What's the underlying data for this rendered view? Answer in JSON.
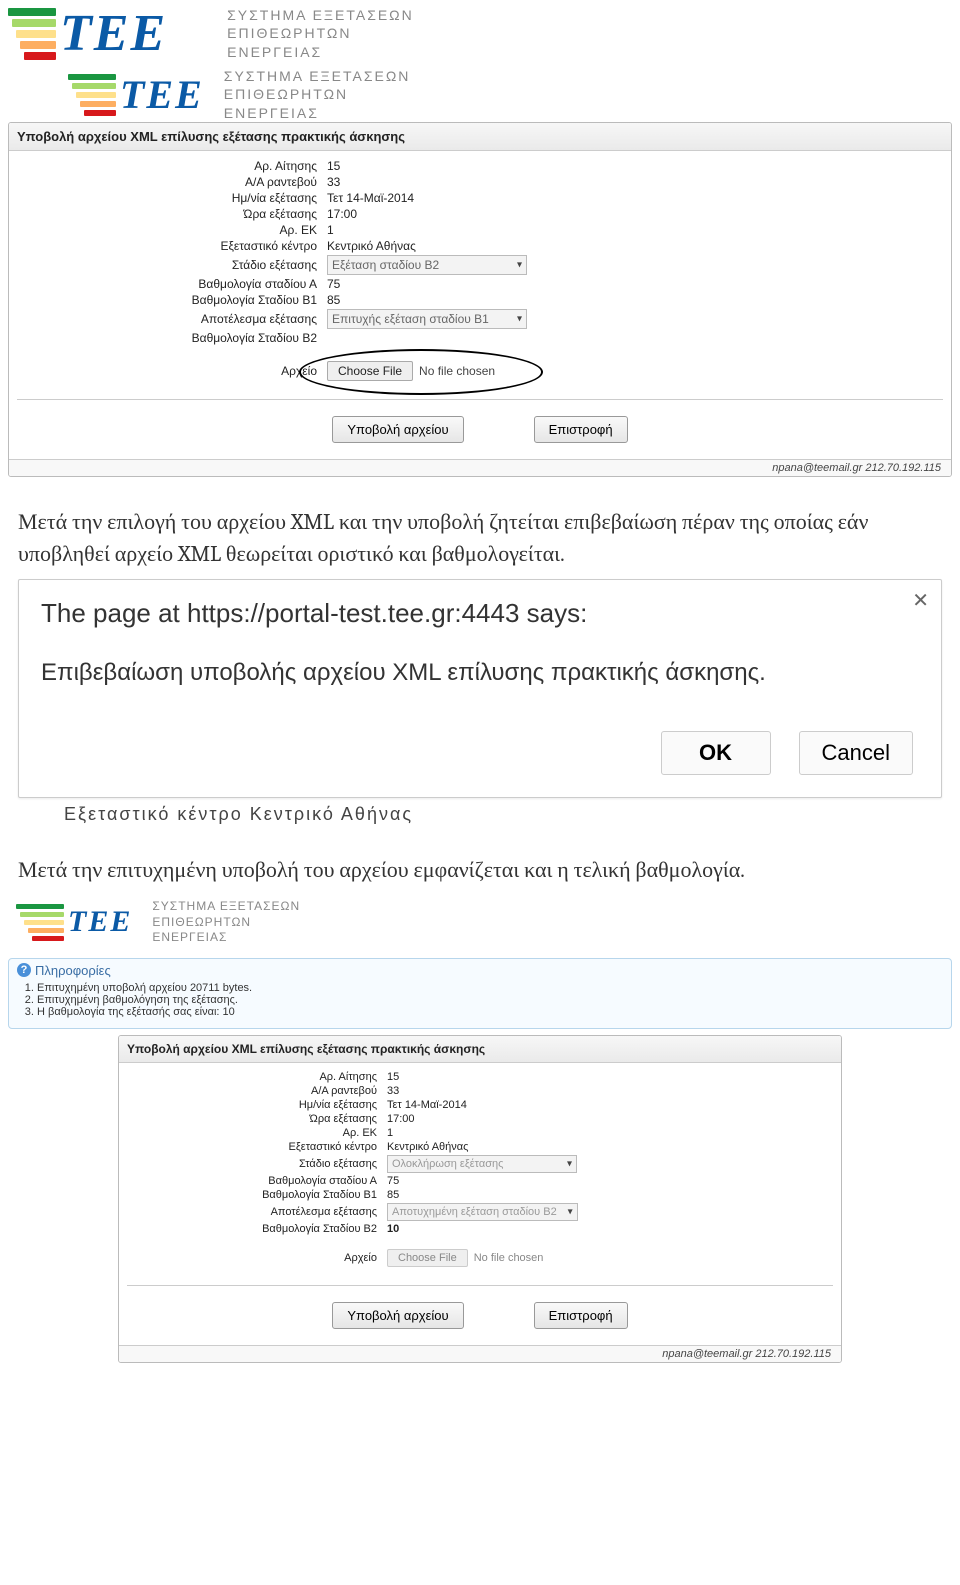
{
  "brand": {
    "name": "ΤΕΕ"
  },
  "system_title": {
    "l1": "ΣΥΣΤΗΜΑ ΕΞΕΤΑΣΕΩΝ",
    "l2": "ΕΠΙΘΕΩΡΗΤΩΝ",
    "l3": "ΕΝΕΡΓΕΙΑΣ"
  },
  "panel1": {
    "title": "Υποβολή αρχείου XML επίλυσης εξέτασης πρακτικής άσκησης",
    "labels": {
      "app_no": "Αρ. Αίτησης",
      "rv_no": "Α/Α ραντεβού",
      "exam_date": "Ημ/νία εξέτασης",
      "exam_time": "Ώρα εξέτασης",
      "ek_no": "Αρ. ΕΚ",
      "center": "Εξεταστικό κέντρο",
      "stage": "Στάδιο εξέτασης",
      "grade_a": "Βαθμολογία σταδίου Α",
      "grade_b1": "Βαθμολογία Σταδίου Β1",
      "result": "Αποτέλεσμα εξέτασης",
      "grade_b2": "Βαθμολογία Σταδίου Β2",
      "file": "Αρχείο"
    },
    "values": {
      "app_no": "15",
      "rv_no": "33",
      "exam_date": "Τετ 14-Μαϊ-2014",
      "exam_time": "17:00",
      "ek_no": "1",
      "center": "Κεντρικό Αθήνας",
      "stage": "Εξέταση σταδίου Β2",
      "grade_a": "75",
      "grade_b1": "85",
      "result": "Επιτυχής εξέταση σταδίου Β1",
      "grade_b2": ""
    },
    "file_chooser": {
      "button": "Choose File",
      "status": "No file chosen"
    },
    "buttons": {
      "submit": "Υποβολή αρχείου",
      "back": "Επιστροφή"
    },
    "footer": "npana@teemail.gr   212.70.192.115"
  },
  "para1": "Μετά την επιλογή του αρχείου XML και την υποβολή ζητείται επιβεβαίωση πέραν της οποίας εάν υποβληθεί αρχείο XML θεωρείται οριστικό και βαθμολογείται.",
  "dialog": {
    "title": "The page at https://portal-test.tee.gr:4443 says:",
    "message": "Επιβεβαίωση υποβολής αρχείου XML επίλυσης πρακτικής άσκησης.",
    "ok": "OK",
    "cancel": "Cancel"
  },
  "cropped_underlay": "Εξεταστικό κέντρο    Κεντρικό Αθήνας",
  "para2": "Μετά την επιτυχημένη υποβολή του αρχείου εμφανίζεται και η τελική βαθμολογία.",
  "info": {
    "title": "Πληροφορίες",
    "items": [
      "Επιτυχημένη υποβολή αρχείου 20711 bytes.",
      "Επιτυχημένη βαθμολόγηση της εξέτασης.",
      "Η βαθμολογία της εξέτασής σας είναι: 10"
    ]
  },
  "panel2": {
    "title": "Υποβολή αρχείου XML επίλυσης εξέτασης πρακτικής άσκησης",
    "values": {
      "app_no": "15",
      "rv_no": "33",
      "exam_date": "Τετ 14-Μαϊ-2014",
      "exam_time": "17:00",
      "ek_no": "1",
      "center": "Κεντρικό Αθήνας",
      "stage": "Ολοκλήρωση εξέτασης",
      "grade_a": "75",
      "grade_b1": "85",
      "result": "Αποτυχημένη εξέταση σταδίου Β2",
      "grade_b2": "10"
    },
    "file_chooser": {
      "button": "Choose File",
      "status": "No file chosen"
    },
    "buttons": {
      "submit": "Υποβολή αρχείου",
      "back": "Επιστροφή"
    },
    "footer": "npana@teemail.gr   212.70.192.115"
  }
}
